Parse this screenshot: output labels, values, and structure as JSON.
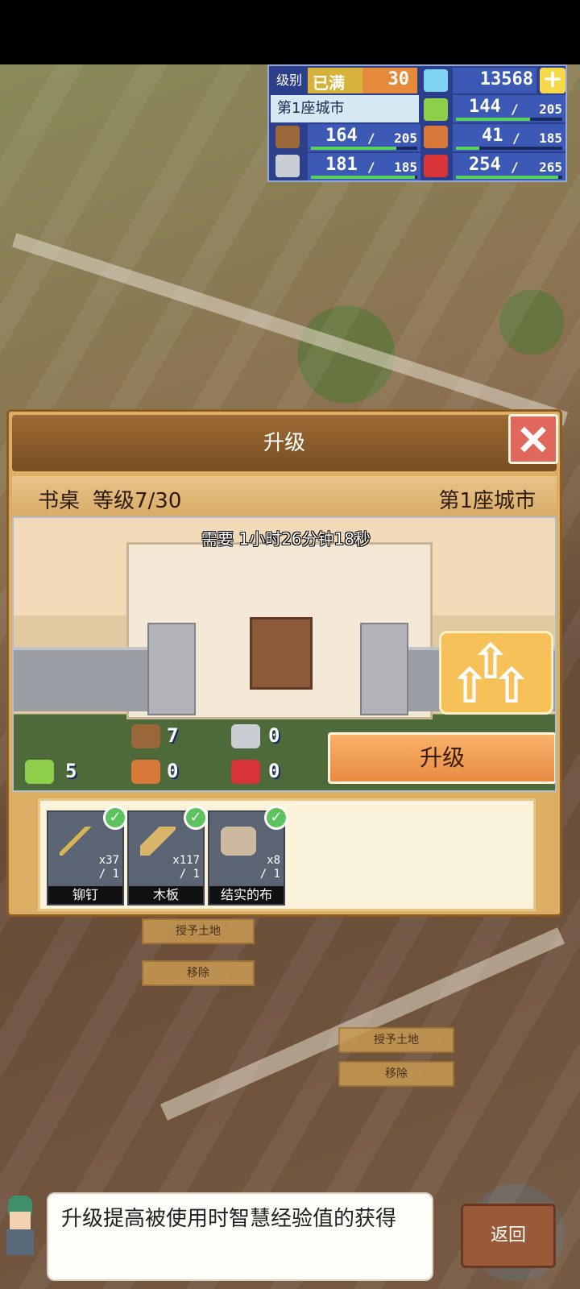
{
  "resources": {
    "level_label": "级别",
    "level_max_label": "已满",
    "level_value": "30",
    "gems": "13568",
    "gems_add": "+",
    "city_name": "第1座城市",
    "food": {
      "current": "144",
      "max": "205",
      "fill": 0.7
    },
    "wood": {
      "current": "164",
      "max": "205",
      "fill": 0.8
    },
    "ore": {
      "current": "181",
      "max": "185",
      "fill": 0.98
    },
    "produce": {
      "current": "41",
      "max": "185",
      "fill": 0.22
    },
    "crystal": {
      "current": "254",
      "max": "265",
      "fill": 0.96
    },
    "separator": "/"
  },
  "background_menus": [
    {
      "label": "授予土地"
    },
    {
      "label": "移除"
    },
    {
      "label": "授予土地"
    },
    {
      "label": "移除"
    }
  ],
  "dialog": {
    "title": "升级",
    "item_name": "书桌",
    "item_level": "等级7/30",
    "city": "第1座城市",
    "time_required": "需要 1小时26分钟18秒",
    "upgrade_button": "升级",
    "costs": {
      "wood": "7",
      "ore": "0",
      "food": "5",
      "produce": "0",
      "crystal": "0"
    },
    "materials": [
      {
        "name": "铆钉",
        "have": "x37",
        "need": "/ 1",
        "icon": "rivet-icon"
      },
      {
        "name": "木板",
        "have": "x117",
        "need": "/ 1",
        "icon": "plank-icon"
      },
      {
        "name": "结实的布",
        "have": "x8",
        "need": "/ 1",
        "icon": "cloth-icon"
      }
    ]
  },
  "tip_text": "升级提高被使用时智慧经验值的获得",
  "return_button": "返回",
  "colors": {
    "accent": "#e88a43",
    "panel": "#2b3f8a",
    "bar": "#58d35a"
  }
}
